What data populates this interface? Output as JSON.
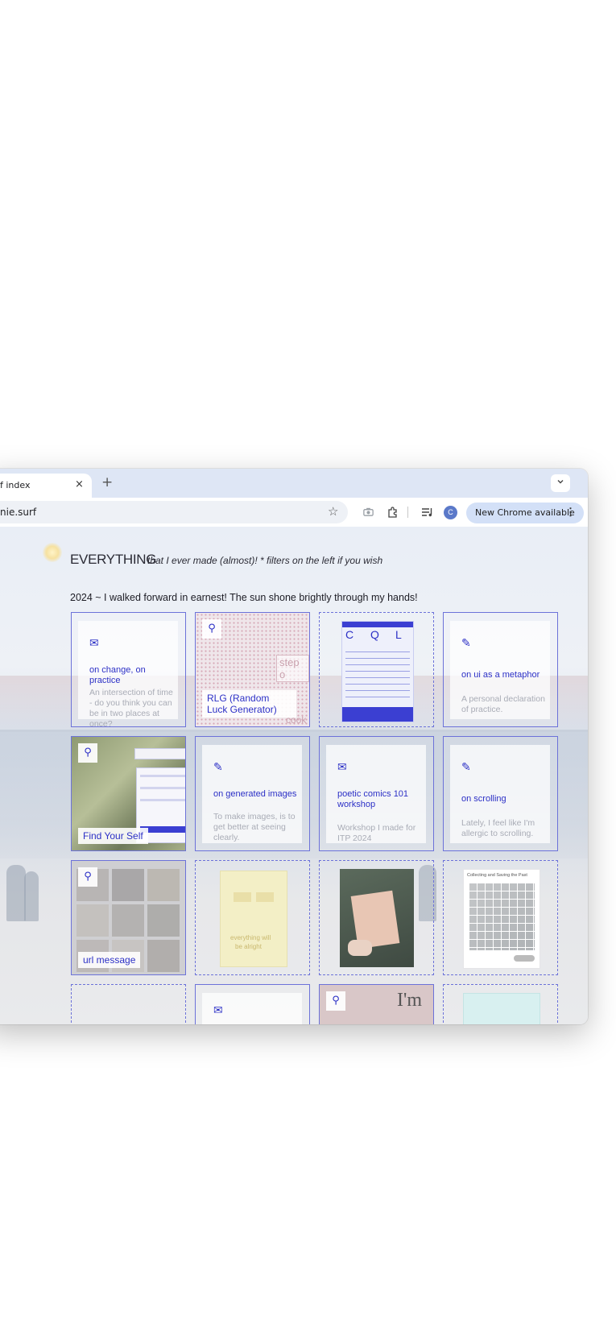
{
  "browser": {
    "tab_title": "f index",
    "tab_close": "×",
    "new_tab": "+",
    "tab_search": "⌄",
    "address": "nie.surf",
    "bookmark": "☆",
    "profile_initial": "C",
    "update_label": "New Chrome available",
    "menu": "⋮"
  },
  "page": {
    "heading": "EVERYTHING",
    "subheading": "that I ever made (almost)! * filters on the left if you wish",
    "year_line": "2024 ~ I walked forward in earnest! The sun shone brightly through my hands!"
  },
  "cards": {
    "change": {
      "icon": "✉",
      "title": "on change, on practice",
      "desc": "An intersection of time - do you think you can be in two places at once?"
    },
    "rlg": {
      "icon": "⚲",
      "title": "RLG (Random Luck Generator)",
      "bg1": "step o",
      "bg2": "cook"
    },
    "poster": {
      "letters": [
        "C",
        "Q",
        "L"
      ]
    },
    "ui": {
      "icon": "✎",
      "title": "on ui as a metaphor",
      "desc": "A personal declaration of practice."
    },
    "find": {
      "icon": "⚲",
      "title": "Find Your Self"
    },
    "gen": {
      "icon": "✎",
      "title": "on generated images",
      "desc": "To make images, is to get better at seeing clearly."
    },
    "comics": {
      "icon": "✉",
      "title": "poetic comics 101 workshop",
      "desc": "Workshop I made for ITP 2024"
    },
    "scroll": {
      "icon": "✎",
      "title": "on scrolling",
      "desc": "Lately, I feel like I'm allergic to scrolling."
    },
    "url": {
      "icon": "⚲",
      "title": "url message"
    },
    "book": {
      "line1": "everything will",
      "line2": "be alright"
    },
    "collect": {
      "title": "Collecting and Saving the Past"
    },
    "row4_mail": {
      "icon": "✉"
    },
    "row4_im": {
      "icon": "⚲",
      "text": "I'm"
    }
  },
  "colors": {
    "accent": "#2c30c6",
    "border": "#6c72d9",
    "muted": "#a9acb6"
  }
}
